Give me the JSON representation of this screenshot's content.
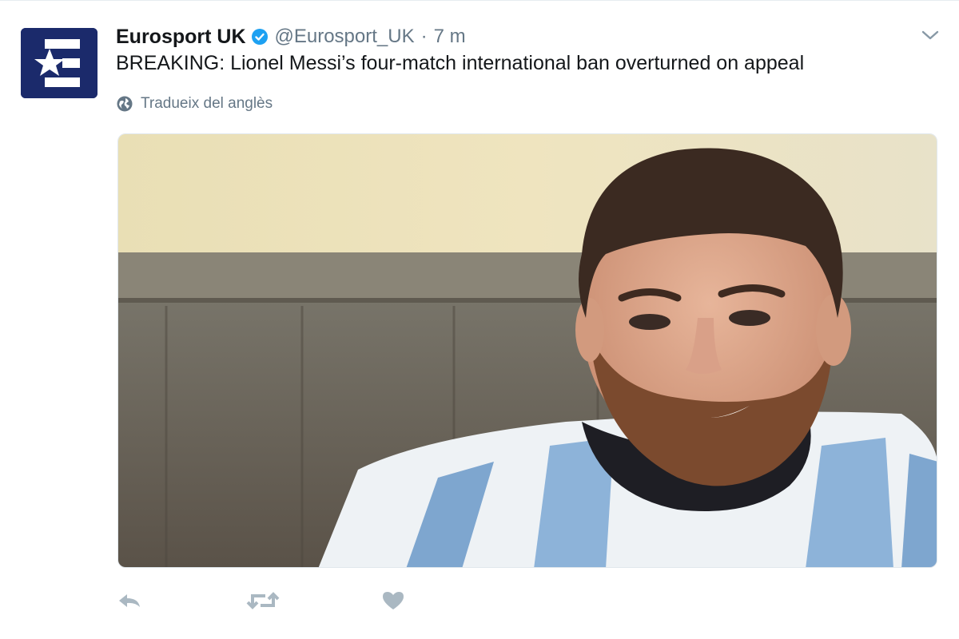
{
  "tweet": {
    "display_name": "Eurosport UK",
    "handle": "@Eurosport_UK",
    "separator": "·",
    "time": "7 m",
    "text": "BREAKING: Lionel Messi’s four-match international ban overturned on appeal",
    "translate_label": "Tradueix del anglès",
    "verified": true
  },
  "colors": {
    "avatar_bg": "#1b2a6b",
    "verified_blue": "#1da1f2",
    "muted": "#657786",
    "text": "#14171a"
  },
  "icons": {
    "avatar": "eurosport-logo-icon",
    "verified": "verified-badge-icon",
    "menu": "chevron-down-icon",
    "translate": "globe-icon",
    "reply": "reply-icon",
    "retweet": "retweet-icon",
    "like": "heart-icon"
  },
  "media": {
    "image_description": "photo"
  }
}
